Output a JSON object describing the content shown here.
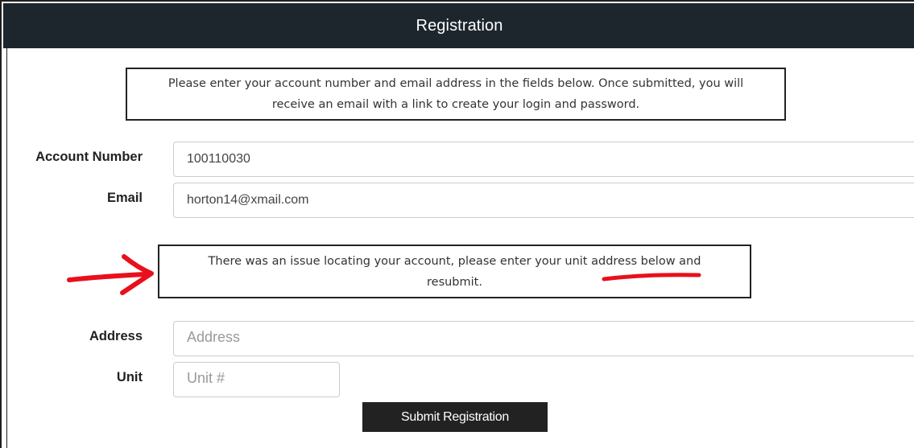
{
  "header": {
    "title": "Registration"
  },
  "intro_notice": {
    "line1": "Please enter your account number and email address in the fields below. Once submitted, you will",
    "line2": "receive an email with a link to create your login and password."
  },
  "form": {
    "account_number": {
      "label": "Account Number",
      "value": "100110030"
    },
    "email": {
      "label": "Email",
      "value": "horton14@xmail.com"
    },
    "address": {
      "label": "Address",
      "value": "",
      "placeholder": "Address"
    },
    "unit": {
      "label": "Unit",
      "value": "",
      "placeholder": "Unit #"
    },
    "submit_label": "Submit Registration"
  },
  "error_notice": {
    "line1": "There was an issue locating your account, please enter your unit address below and",
    "line2": "resubmit."
  },
  "annotation": {
    "color": "#e8101c",
    "marks": [
      "arrow-pointing-at-error",
      "underline-under-address-below"
    ]
  }
}
